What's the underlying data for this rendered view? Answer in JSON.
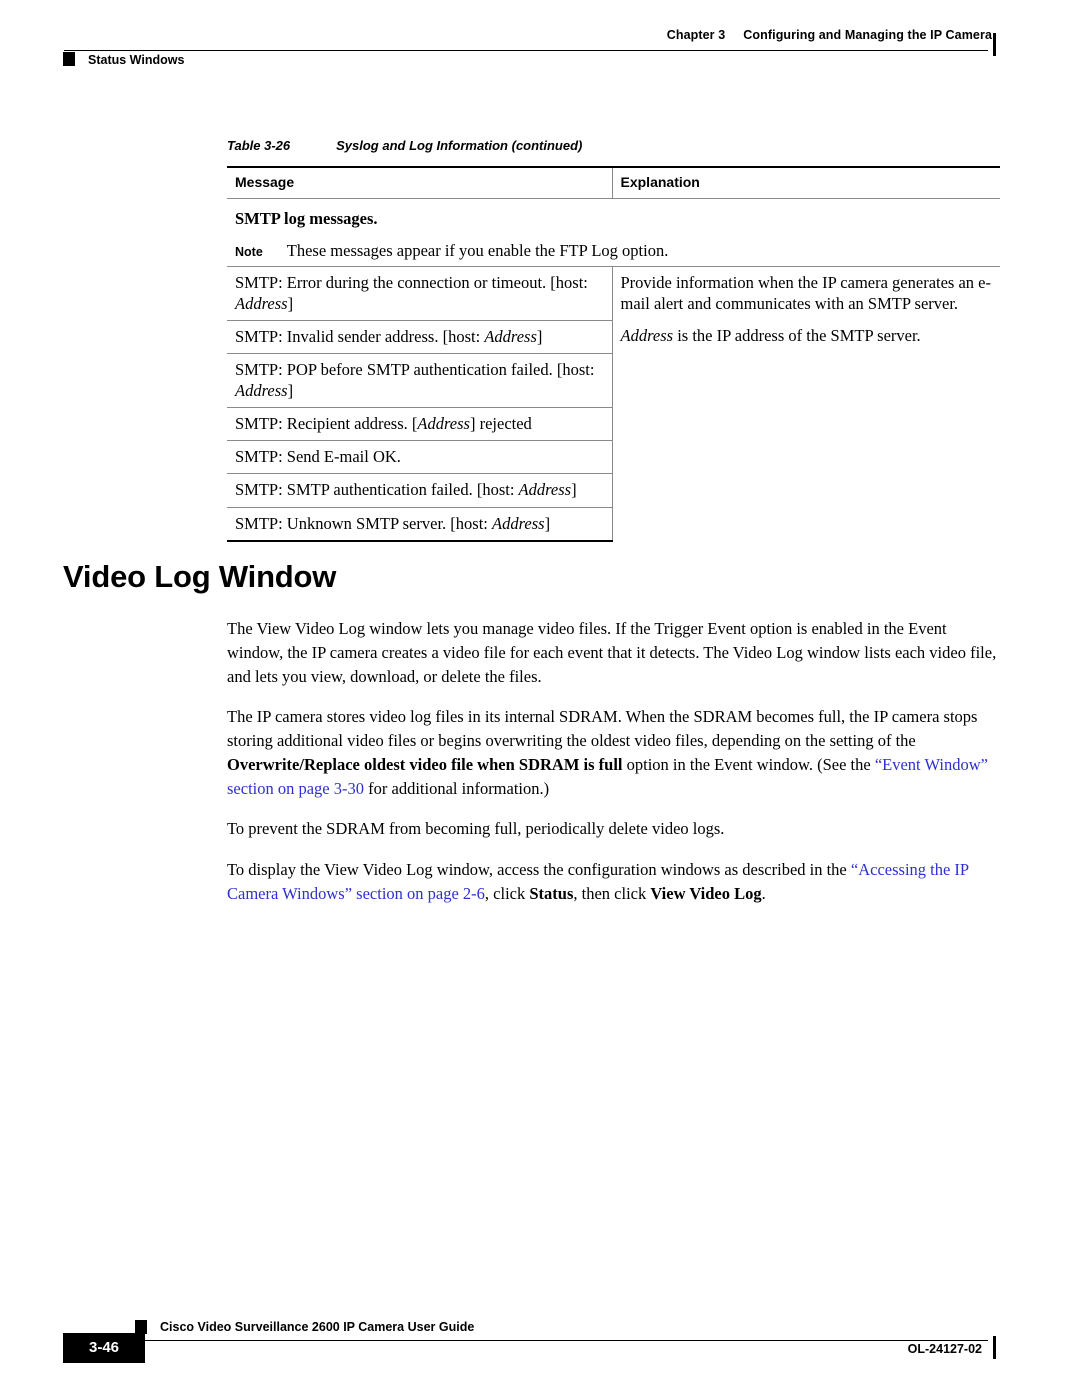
{
  "header": {
    "chapter_number": "Chapter 3",
    "chapter_title": "Configuring and Managing the IP Camera",
    "section": "Status Windows"
  },
  "table": {
    "caption_label": "Table 3-26",
    "caption_title": "Syslog and Log Information (continued)",
    "columns": [
      "Message",
      "Explanation"
    ],
    "group_heading": "SMTP log messages.",
    "note_label": "Note",
    "note_text": "These messages appear if you enable the FTP Log option.",
    "rows": [
      {
        "message_pre": "SMTP: Error during the connection or timeout. [host: ",
        "message_em": "Address",
        "message_post": "]"
      },
      {
        "message_pre": "SMTP: Invalid sender address. [host: ",
        "message_em": "Address",
        "message_post": "]"
      },
      {
        "message_pre": "SMTP: POP before SMTP authentication failed. [host: ",
        "message_em": "Address",
        "message_post": "]"
      },
      {
        "message_pre": "SMTP: Recipient address. [",
        "message_em": "Address",
        "message_post": "] rejected"
      },
      {
        "message_pre": "SMTP: Send E-mail OK.",
        "message_em": "",
        "message_post": ""
      },
      {
        "message_pre": "SMTP: SMTP authentication failed. [host: ",
        "message_em": "Address",
        "message_post": "]"
      },
      {
        "message_pre": "SMTP: Unknown SMTP server. [host: ",
        "message_em": "Address",
        "message_post": "]"
      }
    ],
    "explanation": {
      "paragraph1": "Provide information when the IP camera generates an e-mail alert and communicates with an SMTP server.",
      "paragraph2_em": "Address",
      "paragraph2_rest": " is the IP address of the SMTP server."
    }
  },
  "heading": {
    "video_log_window": "Video Log Window"
  },
  "body": {
    "p1": "The View Video Log window lets you manage video files. If the Trigger Event option is enabled in the Event window, the IP camera creates a video file for each event that it detects. The Video Log window lists each video file, and lets you view, download, or delete the files.",
    "p2_part1": "The IP camera stores video log files in its internal SDRAM. When the SDRAM becomes full, the IP camera stops storing additional video files or begins overwriting the oldest video files, depending on the setting of the ",
    "p2_bold": "Overwrite/Replace oldest video file when SDRAM is full",
    "p2_part2": " option in the Event window. (See the ",
    "p2_link": "“Event Window” section on page 3-30",
    "p2_part3": " for additional information.)",
    "p3": "To prevent the SDRAM from becoming full, periodically delete video logs.",
    "p4_part1": "To display the View Video Log window, access the configuration windows as described in the ",
    "p4_link": "“Accessing the IP Camera Windows” section on page 2-6",
    "p4_part2": ", click ",
    "p4_bold1": "Status",
    "p4_part3": ", then click ",
    "p4_bold2": "View Video Log",
    "p4_part4": "."
  },
  "footer": {
    "guide_title": "Cisco Video Surveillance 2600 IP Camera User Guide",
    "page_number": "3-46",
    "doc_number": "OL-24127-02"
  },
  "colors": {
    "link": "#2f2fd4",
    "rule": "#000000",
    "table_rule_light": "#8a8a8a"
  }
}
